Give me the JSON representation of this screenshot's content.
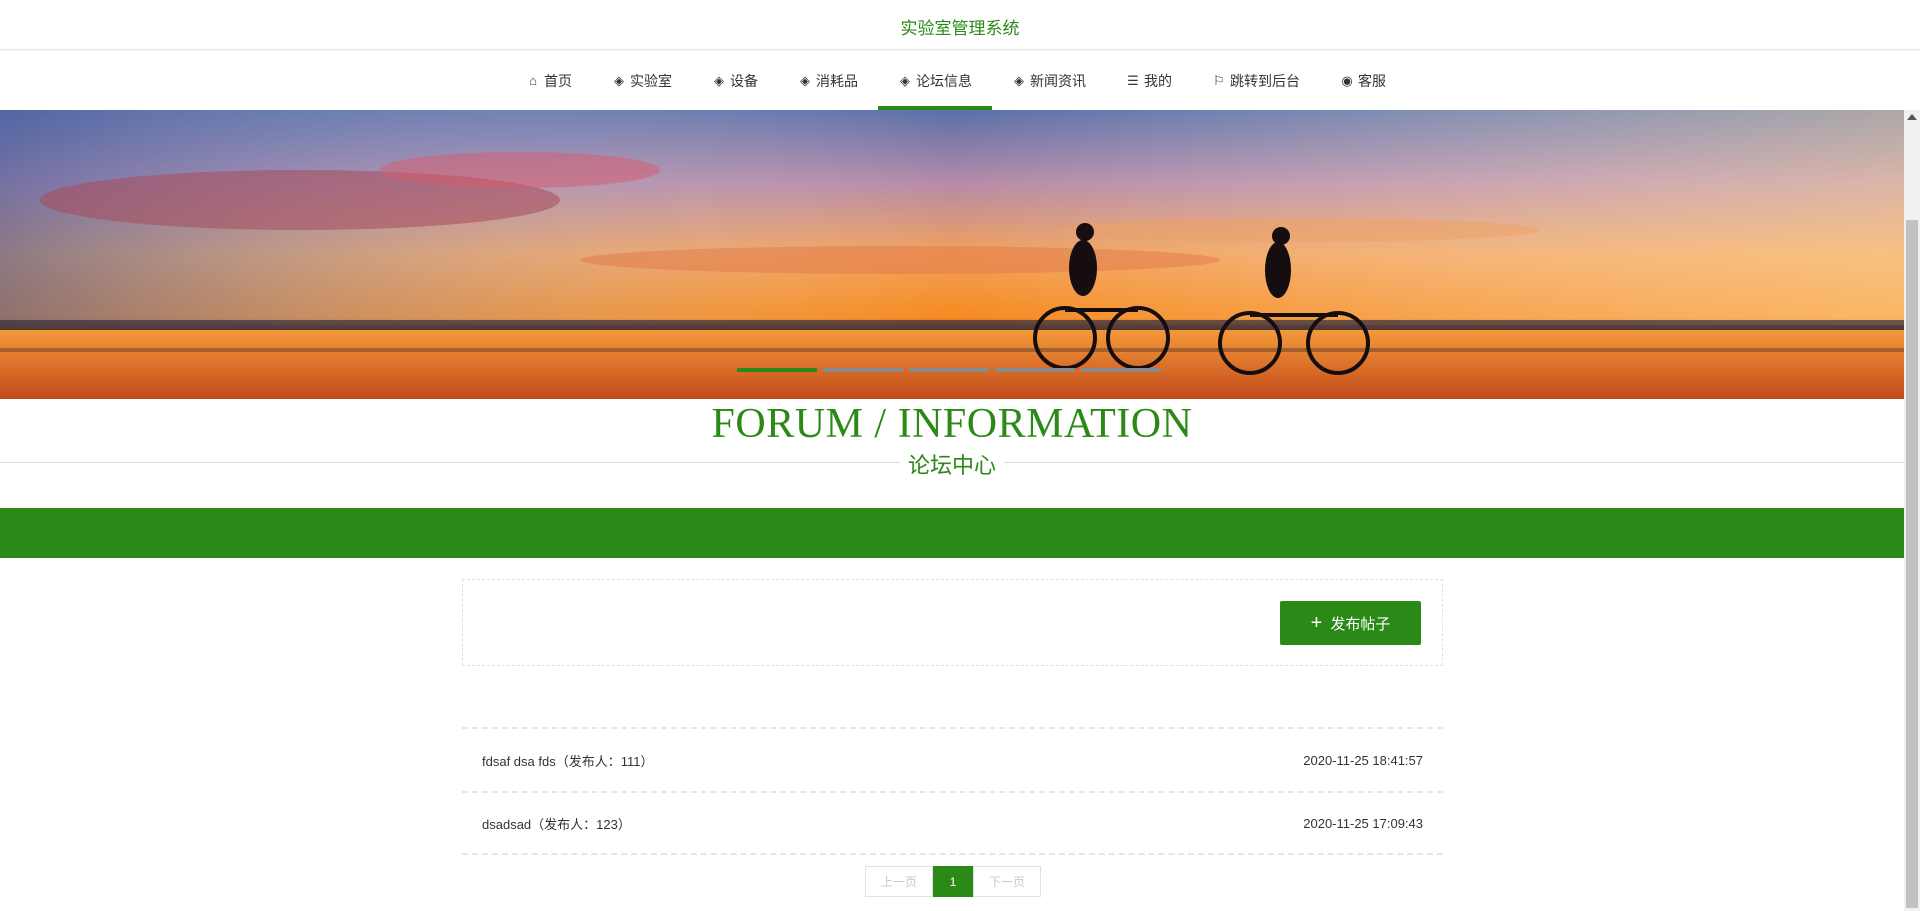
{
  "site": {
    "title": "实验室管理系统"
  },
  "nav": {
    "items": [
      {
        "label": "首页",
        "icon": "home-icon",
        "glyph": "⌂"
      },
      {
        "label": "实验室",
        "icon": "layers-icon",
        "glyph": "◈"
      },
      {
        "label": "设备",
        "icon": "layers-icon",
        "glyph": "◈"
      },
      {
        "label": "消耗品",
        "icon": "layers-icon",
        "glyph": "◈"
      },
      {
        "label": "论坛信息",
        "icon": "layers-icon",
        "glyph": "◈",
        "active": true
      },
      {
        "label": "新闻资讯",
        "icon": "layers-icon",
        "glyph": "◈"
      },
      {
        "label": "我的",
        "icon": "list-icon",
        "glyph": "☰"
      },
      {
        "label": "跳转到后台",
        "icon": "flag-icon",
        "glyph": "⚐"
      },
      {
        "label": "客服",
        "icon": "chat-icon",
        "glyph": "◉"
      }
    ]
  },
  "banner": {
    "slides": 5,
    "active_slide": 1
  },
  "section": {
    "title_en": "FORUM / INFORMATION",
    "title_cn": "论坛中心"
  },
  "toolbar": {
    "post_button": "发布帖子",
    "post_icon": "plus-icon"
  },
  "posts": [
    {
      "title": "fdsaf dsa fds（发布人：111）",
      "time": "2020-11-25 18:41:57"
    },
    {
      "title": "dsadsad（发布人：123）",
      "time": "2020-11-25 17:09:43"
    }
  ],
  "pager": {
    "prev": "上一页",
    "current": "1",
    "next": "下一页"
  },
  "colors": {
    "accent": "#2b8a17"
  }
}
